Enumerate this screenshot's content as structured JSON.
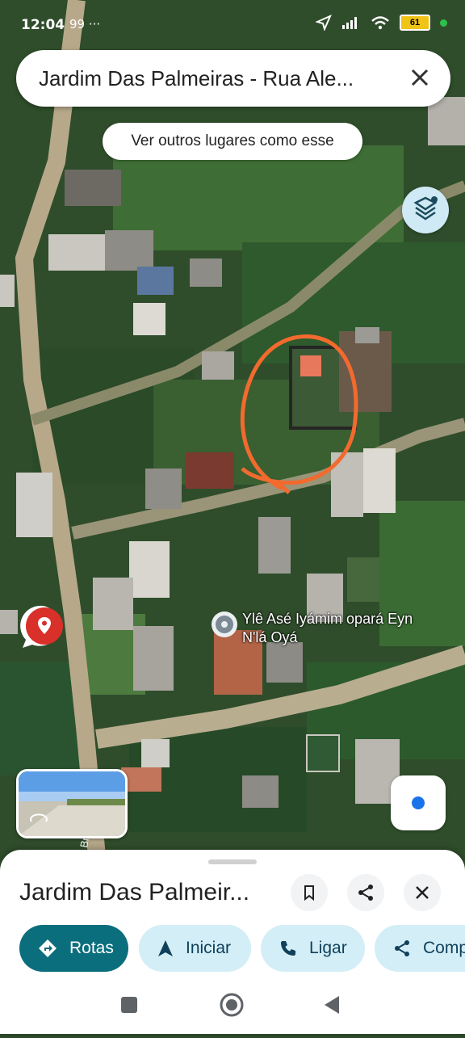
{
  "status_bar": {
    "time": "12:04",
    "extra": "99 ···",
    "battery": "61"
  },
  "search": {
    "text": "Jardim Das Palmeiras - Rua Ale..."
  },
  "chip": {
    "label": "Ver outros lugares como esse"
  },
  "map": {
    "poi_label": "Ylê Asé Iyámim opará Eyn N'lá Oyá",
    "street_label": "Br"
  },
  "sheet": {
    "title": "Jardim Das Palmeir...",
    "actions": [
      {
        "label": "Rotas",
        "icon": "directions-icon"
      },
      {
        "label": "Iniciar",
        "icon": "navigation-arrow-icon"
      },
      {
        "label": "Ligar",
        "icon": "phone-icon"
      },
      {
        "label": "Comp",
        "icon": "share-icon"
      }
    ]
  },
  "colors": {
    "primary": "#0b6e7d",
    "secondary": "#d3eef7",
    "annotation": "#f26a2e"
  }
}
